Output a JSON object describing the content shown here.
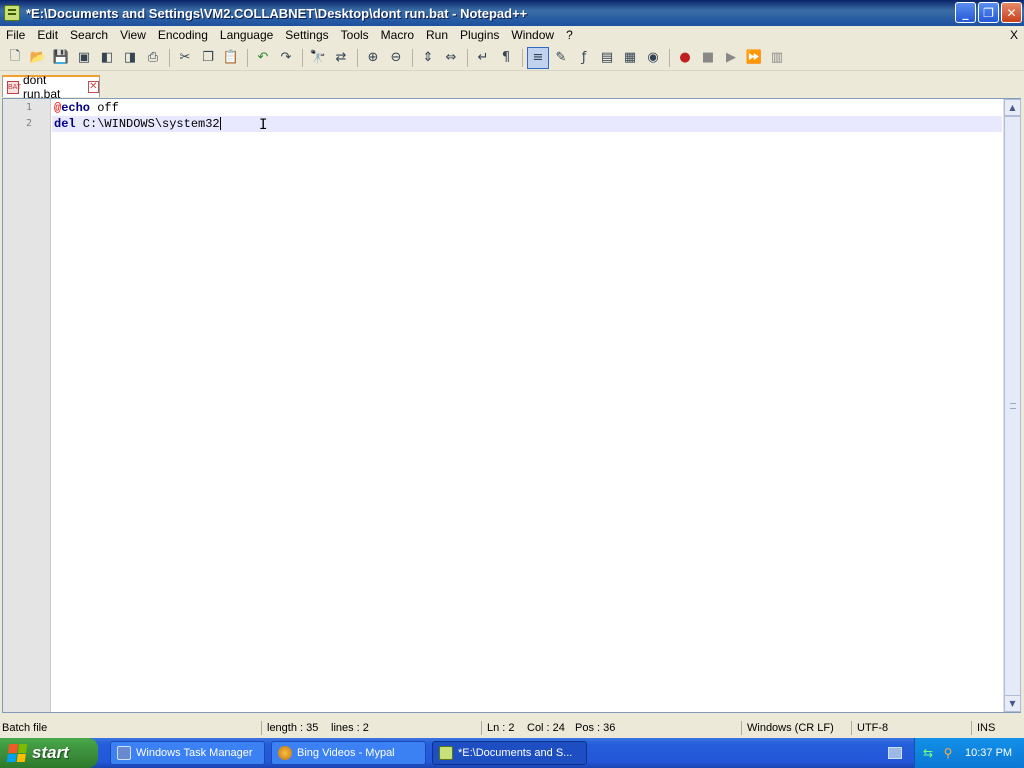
{
  "window": {
    "title": "*E:\\Documents and Settings\\VM2.COLLABNET\\Desktop\\dont run.bat - Notepad++",
    "min_label": "_",
    "max_label": "❐",
    "close_label": "✕"
  },
  "menu": {
    "items": [
      "File",
      "Edit",
      "Search",
      "View",
      "Encoding",
      "Language",
      "Settings",
      "Tools",
      "Macro",
      "Run",
      "Plugins",
      "Window",
      "?"
    ],
    "close": "X"
  },
  "toolbar": {
    "icons": [
      "new-file-icon",
      "open-file-icon",
      "save-icon",
      "save-all-icon",
      "close-icon",
      "close-all-icon",
      "print-icon",
      "cut-icon",
      "copy-icon",
      "paste-icon",
      "undo-icon",
      "redo-icon",
      "find-icon",
      "replace-icon",
      "zoom-in-icon",
      "zoom-out-icon",
      "sync-vertical-icon",
      "sync-horizontal-icon",
      "word-wrap-icon",
      "show-all-chars-icon",
      "indent-guide-icon",
      "user-language-icon",
      "function-list-icon",
      "doc-map-icon",
      "folder-workspace-icon",
      "monitoring-icon",
      "record-macro-icon",
      "stop-record-icon",
      "play-macro-icon",
      "run-macro-multiple-icon",
      "save-macro-icon"
    ]
  },
  "tab": {
    "label": "dont run.bat",
    "icon_text": "BAT",
    "close": "✕"
  },
  "editor": {
    "line_numbers": [
      "1",
      "2"
    ],
    "lines": [
      {
        "at": "@",
        "keyword": "echo",
        "rest": " off"
      },
      {
        "at": "",
        "keyword": "del",
        "rest": " C:\\WINDOWS\\system32"
      }
    ],
    "ibeam": "I"
  },
  "status": {
    "language": "Batch file",
    "length": "length : 35",
    "lines": "lines : 2",
    "ln": "Ln : 2",
    "col": "Col : 24",
    "pos": "Pos : 36",
    "eol": "Windows (CR LF)",
    "encoding": "UTF-8",
    "mode": "INS"
  },
  "taskbar": {
    "start_label": "start",
    "tasks": [
      {
        "label": "Windows Task Manager",
        "active": false
      },
      {
        "label": "Bing Videos - Mypal",
        "active": false
      },
      {
        "label": "*E:\\Documents and S...",
        "active": true
      }
    ],
    "clock": "10:37 PM"
  }
}
